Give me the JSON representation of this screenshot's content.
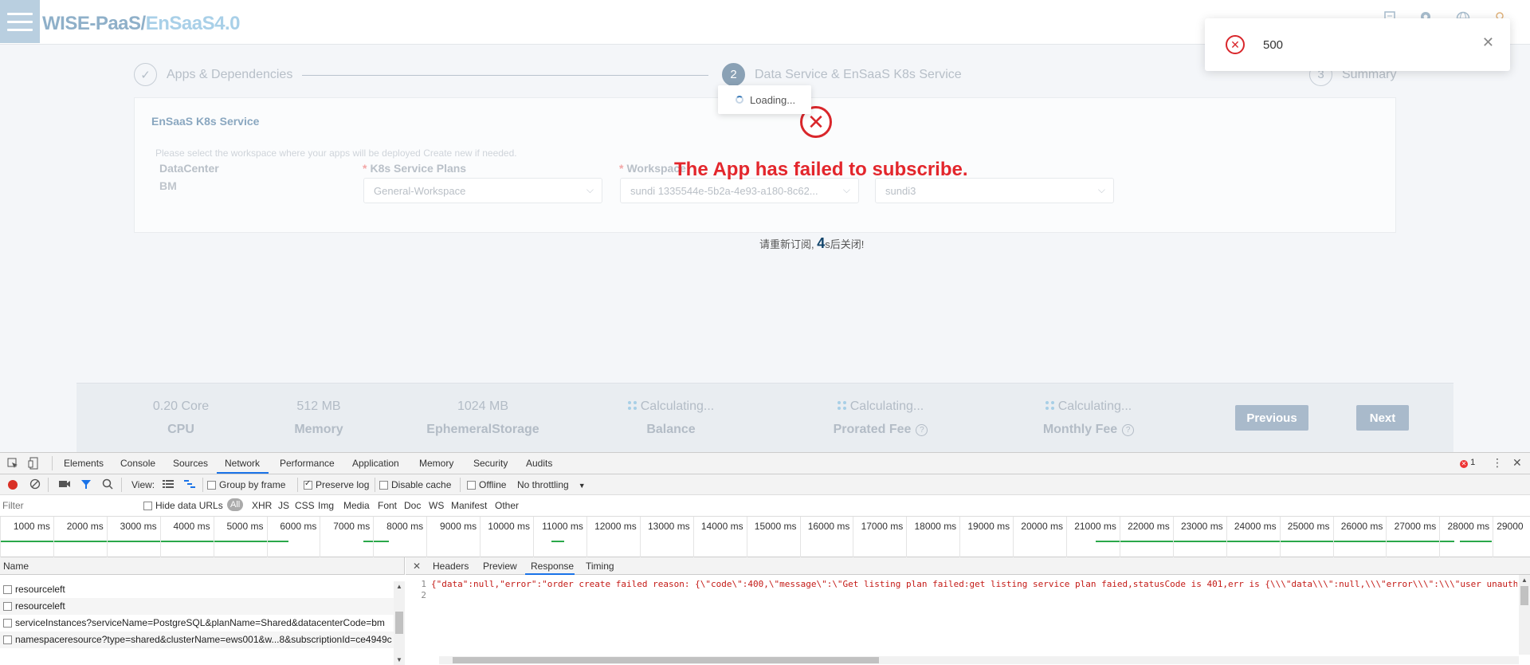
{
  "app": {
    "logo_part1": "WISE-PaaS/",
    "logo_part2": "EnSaaS4.0",
    "steps": [
      {
        "label": "Apps & Dependencies",
        "icon": "check-icon",
        "number": "✓"
      },
      {
        "label": "Data Service & EnSaaS K8s Service",
        "number": "2"
      },
      {
        "label": "Summary",
        "number": "3"
      }
    ],
    "card": {
      "title": "EnSaaS K8s Service",
      "hint": "Please select the workspace where your apps will be deployed Create new if needed.",
      "datacenter_label": "DataCenter",
      "datacenter_value": "BM",
      "plans_label": "K8s Service Plans",
      "plans_value": "General-Workspace",
      "workspace_label": "Workspace",
      "workspace_value": "sundi 1335544e-5b2a-4e93-a180-8c62...",
      "namespace_value": "sundi3"
    },
    "error": {
      "message": "The App has failed to subscribe.",
      "countdown_prefix": "请重新订阅,",
      "countdown_number": "4",
      "countdown_suffix": "s后关闭!"
    },
    "loading_text": "Loading...",
    "toast": {
      "message": "500"
    },
    "summary": {
      "cpu_value": "0.20 Core",
      "cpu_label": "CPU",
      "memory_value": "512 MB",
      "memory_label": "Memory",
      "storage_value": "1024 MB",
      "storage_label": "EphemeralStorage",
      "balance_value": "Calculating...",
      "balance_label": "Balance",
      "prorated_value": "Calculating...",
      "prorated_label": "Prorated Fee",
      "monthly_value": "Calculating...",
      "monthly_label": "Monthly Fee",
      "help_glyph": "?"
    },
    "buttons": {
      "previous": "Previous",
      "next": "Next"
    }
  },
  "devtools": {
    "tabs": [
      "Elements",
      "Console",
      "Sources",
      "Network",
      "Performance",
      "Application",
      "Memory",
      "Security",
      "Audits"
    ],
    "active_tab": "Network",
    "error_count": "1",
    "toolbar": {
      "view_label": "View:",
      "group_by_frame": "Group by frame",
      "preserve_log": "Preserve log",
      "disable_cache": "Disable cache",
      "offline": "Offline",
      "throttling": "No throttling"
    },
    "filter": {
      "placeholder": "Filter",
      "hide_data_urls": "Hide data URLs",
      "types": [
        "All",
        "XHR",
        "JS",
        "CSS",
        "Img",
        "Media",
        "Font",
        "Doc",
        "WS",
        "Manifest",
        "Other"
      ]
    },
    "timeline_ticks": [
      "1000 ms",
      "2000 ms",
      "3000 ms",
      "4000 ms",
      "5000 ms",
      "6000 ms",
      "7000 ms",
      "8000 ms",
      "9000 ms",
      "10000 ms",
      "11000 ms",
      "12000 ms",
      "13000 ms",
      "14000 ms",
      "15000 ms",
      "16000 ms",
      "17000 ms",
      "18000 ms",
      "19000 ms",
      "20000 ms",
      "21000 ms",
      "22000 ms",
      "23000 ms",
      "24000 ms",
      "25000 ms",
      "26000 ms",
      "27000 ms",
      "28000 ms",
      "29000"
    ],
    "name_header": "Name",
    "requests": [
      "resourceleft",
      "resourceleft",
      "serviceInstances?serviceName=PostgreSQL&planName=Shared&datacenterCode=bm",
      "namespaceresource?type=shared&clusterName=ews001&w...8&subscriptionId=ce4949c"
    ],
    "detail_tabs": [
      "Headers",
      "Preview",
      "Response",
      "Timing"
    ],
    "active_detail_tab": "Response",
    "response_lines": [
      {
        "num": "1",
        "text": "{\"data\":null,\"error\":\"order create failed reason: {\\\"code\\\":400,\\\"message\\\":\\\"Get listing plan failed:get listing service plan faied,statusCode is 401,err is {\\\\\\\"data\\\\\\\":null,\\\\\\\"error\\\\\\\":\\\\\\\"user unauth"
      },
      {
        "num": "2",
        "text": ""
      }
    ]
  },
  "colors": {
    "error_red": "#e3262c",
    "accent_blue": "#1a73e8",
    "button_gray_blue": "#a9bacb"
  }
}
